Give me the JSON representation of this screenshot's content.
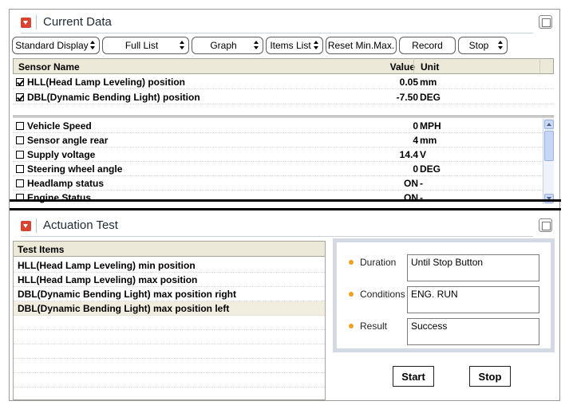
{
  "current_data": {
    "title": "Current Data",
    "toolbar": [
      {
        "label": "Standard Display",
        "has_arrow": true
      },
      {
        "label": "Full List",
        "has_arrow": true
      },
      {
        "label": "Graph",
        "has_arrow": true
      },
      {
        "label": "Items List",
        "has_arrow": true
      },
      {
        "label": "Reset Min.Max.",
        "has_arrow": false
      },
      {
        "label": "Record",
        "has_arrow": false
      },
      {
        "label": "Stop",
        "has_arrow": true
      }
    ],
    "columns": {
      "name": "Sensor Name",
      "value": "Value",
      "unit": "Unit"
    },
    "fixed_rows": [
      {
        "name": "HLL(Head Lamp Leveling) position",
        "value": "0.05",
        "unit": "mm",
        "checked": true
      },
      {
        "name": "DBL(Dynamic Bending Light) position",
        "value": "-7.50",
        "unit": "DEG",
        "checked": true
      }
    ],
    "rows": [
      {
        "name": "Vehicle Speed",
        "value": "0",
        "unit": "MPH",
        "checked": false
      },
      {
        "name": "Sensor angle rear",
        "value": "4",
        "unit": "mm",
        "checked": false
      },
      {
        "name": "Supply voltage",
        "value": "14.4",
        "unit": "V",
        "checked": false
      },
      {
        "name": "Steering wheel angle",
        "value": "0",
        "unit": "DEG",
        "checked": false
      },
      {
        "name": "Headlamp status",
        "value": "ON",
        "unit": "-",
        "checked": false
      },
      {
        "name": "Engine Status",
        "value": "ON",
        "unit": "-",
        "checked": false
      }
    ]
  },
  "actuation_test": {
    "title": "Actuation Test",
    "list_header": "Test Items",
    "items": [
      {
        "label": "HLL(Head Lamp Leveling) min position",
        "selected": false
      },
      {
        "label": "HLL(Head Lamp Leveling) max position",
        "selected": false
      },
      {
        "label": "DBL(Dynamic Bending Light) max position right",
        "selected": false
      },
      {
        "label": "DBL(Dynamic Bending Light) max position left",
        "selected": true
      }
    ],
    "info": [
      {
        "label": "Duration",
        "value": "Until Stop Button"
      },
      {
        "label": "Conditions",
        "value": "ENG. RUN"
      },
      {
        "label": "Result",
        "value": "Success"
      }
    ],
    "start_label": "Start",
    "stop_label": "Stop"
  },
  "colors": {
    "collapse_icon": "#d9432f",
    "bullet": "#f0a020",
    "header_bg": "#ece9d8"
  }
}
